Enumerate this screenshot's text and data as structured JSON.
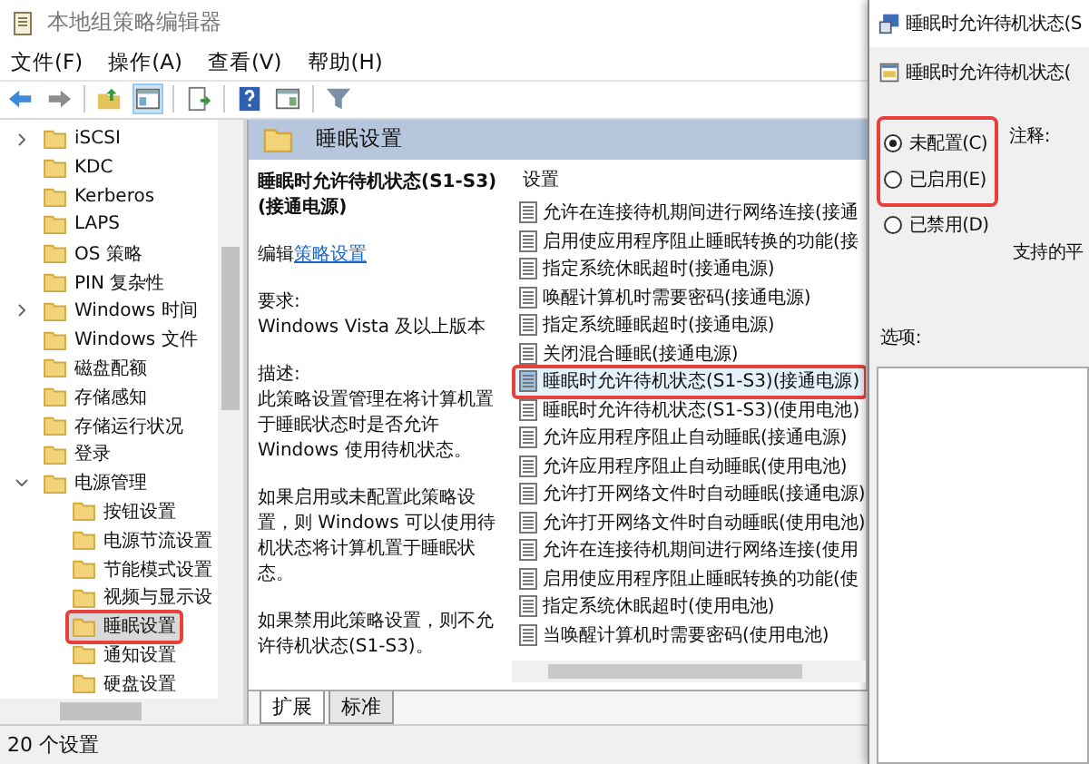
{
  "window": {
    "title": "本地组策略编辑器"
  },
  "menu": [
    "文件(F)",
    "操作(A)",
    "查看(V)",
    "帮助(H)"
  ],
  "tree": [
    {
      "label": "iSCSI",
      "expanded": false,
      "selected": false,
      "highlighted": false
    },
    {
      "label": "KDC",
      "selected": false,
      "highlighted": false
    },
    {
      "label": "Kerberos",
      "selected": false,
      "highlighted": false
    },
    {
      "label": "LAPS",
      "selected": false,
      "highlighted": false
    },
    {
      "label": "OS 策略",
      "selected": false,
      "highlighted": false
    },
    {
      "label": "PIN 复杂性",
      "selected": false,
      "highlighted": false
    },
    {
      "label": "Windows 时间",
      "expanded": false,
      "selected": false,
      "highlighted": false
    },
    {
      "label": "Windows 文件",
      "selected": false,
      "highlighted": false
    },
    {
      "label": "磁盘配额",
      "selected": false,
      "highlighted": false
    },
    {
      "label": "存储感知",
      "selected": false,
      "highlighted": false
    },
    {
      "label": "存储运行状况",
      "selected": false,
      "highlighted": false
    },
    {
      "label": "登录",
      "selected": false,
      "highlighted": false
    },
    {
      "label": "电源管理",
      "expanded": true,
      "selected": false,
      "highlighted": false,
      "children": [
        {
          "label": "按钮设置",
          "selected": false,
          "highlighted": false
        },
        {
          "label": "电源节流设置",
          "selected": false,
          "highlighted": false
        },
        {
          "label": "节能模式设置",
          "selected": false,
          "highlighted": false
        },
        {
          "label": "视频与显示设",
          "selected": false,
          "highlighted": false
        },
        {
          "label": "睡眠设置",
          "selected": true,
          "highlighted": true
        },
        {
          "label": "通知设置",
          "selected": false,
          "highlighted": false
        },
        {
          "label": "硬盘设置",
          "selected": false,
          "highlighted": false
        }
      ]
    }
  ],
  "pane": {
    "header": "睡眠设置",
    "description": {
      "title": "睡眠时允许待机状态(S1-S3)(接通电源)",
      "edit_prefix": "编辑",
      "edit_link": "策略设置",
      "requirements_label": "要求:",
      "requirements": "Windows Vista 及以上版本",
      "description_label": "描述:",
      "paragraphs": [
        "此策略设置管理在将计算机置于睡眠状态时是否允许 Windows 使用待机状态。",
        "如果启用或未配置此策略设置，则 Windows 可以使用待机状态将计算机置于睡眠状态。",
        "如果禁用此策略设置，则不允许待机状态(S1-S3)。"
      ]
    },
    "settings_header": "设置",
    "settings": [
      {
        "label": "允许在连接待机期间进行网络连接(接通",
        "selected": false,
        "highlighted": false
      },
      {
        "label": "启用使应用程序阻止睡眠转换的功能(接",
        "selected": false,
        "highlighted": false
      },
      {
        "label": "指定系统休眠超时(接通电源)",
        "selected": false,
        "highlighted": false
      },
      {
        "label": "唤醒计算机时需要密码(接通电源)",
        "selected": false,
        "highlighted": false
      },
      {
        "label": "指定系统睡眠超时(接通电源)",
        "selected": false,
        "highlighted": false
      },
      {
        "label": "关闭混合睡眠(接通电源)",
        "selected": false,
        "highlighted": false
      },
      {
        "label": "睡眠时允许待机状态(S1-S3)(接通电源)",
        "selected": true,
        "highlighted": true
      },
      {
        "label": "睡眠时允许待机状态(S1-S3)(使用电池)",
        "selected": false,
        "highlighted": false
      },
      {
        "label": "允许应用程序阻止自动睡眠(接通电源)",
        "selected": false,
        "highlighted": false
      },
      {
        "label": "允许应用程序阻止自动睡眠(使用电池)",
        "selected": false,
        "highlighted": false
      },
      {
        "label": "允许打开网络文件时自动睡眠(接通电源)",
        "selected": false,
        "highlighted": false
      },
      {
        "label": "允许打开网络文件时自动睡眠(使用电池)",
        "selected": false,
        "highlighted": false
      },
      {
        "label": "允许在连接待机期间进行网络连接(使用",
        "selected": false,
        "highlighted": false
      },
      {
        "label": "启用使应用程序阻止睡眠转换的功能(使",
        "selected": false,
        "highlighted": false
      },
      {
        "label": "指定系统休眠超时(使用电池)",
        "selected": false,
        "highlighted": false
      },
      {
        "label": "当唤醒计算机时需要密码(使用电池)",
        "selected": false,
        "highlighted": false
      }
    ],
    "tabs": [
      {
        "label": "扩展",
        "selected": true
      },
      {
        "label": "标准",
        "selected": false
      }
    ]
  },
  "status_bar": "20 个设置",
  "dialog": {
    "title": "睡眠时允许待机状态(S",
    "subtitle": "睡眠时允许待机状态(",
    "options": [
      {
        "label": "未配置(C)",
        "selected": true,
        "highlighted": true
      },
      {
        "label": "已启用(E)",
        "selected": false,
        "highlighted": true
      },
      {
        "label": "已禁用(D)",
        "selected": false,
        "highlighted": false
      }
    ],
    "comment_label": "注释:",
    "supported_label": "支持的平",
    "options_label": "选项:"
  }
}
